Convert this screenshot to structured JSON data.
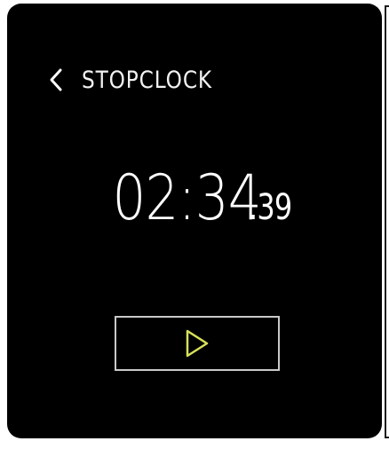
{
  "header": {
    "back_icon": "chevron-left-icon",
    "title": "STOPCLOCK"
  },
  "timer": {
    "main": "02:34",
    "fraction": ".39"
  },
  "controls": {
    "play_icon": "play-icon",
    "play_color": "#d6e05a",
    "border_color": "#c9c9c9"
  },
  "colors": {
    "background": "#000000",
    "text": "#ffffff"
  }
}
